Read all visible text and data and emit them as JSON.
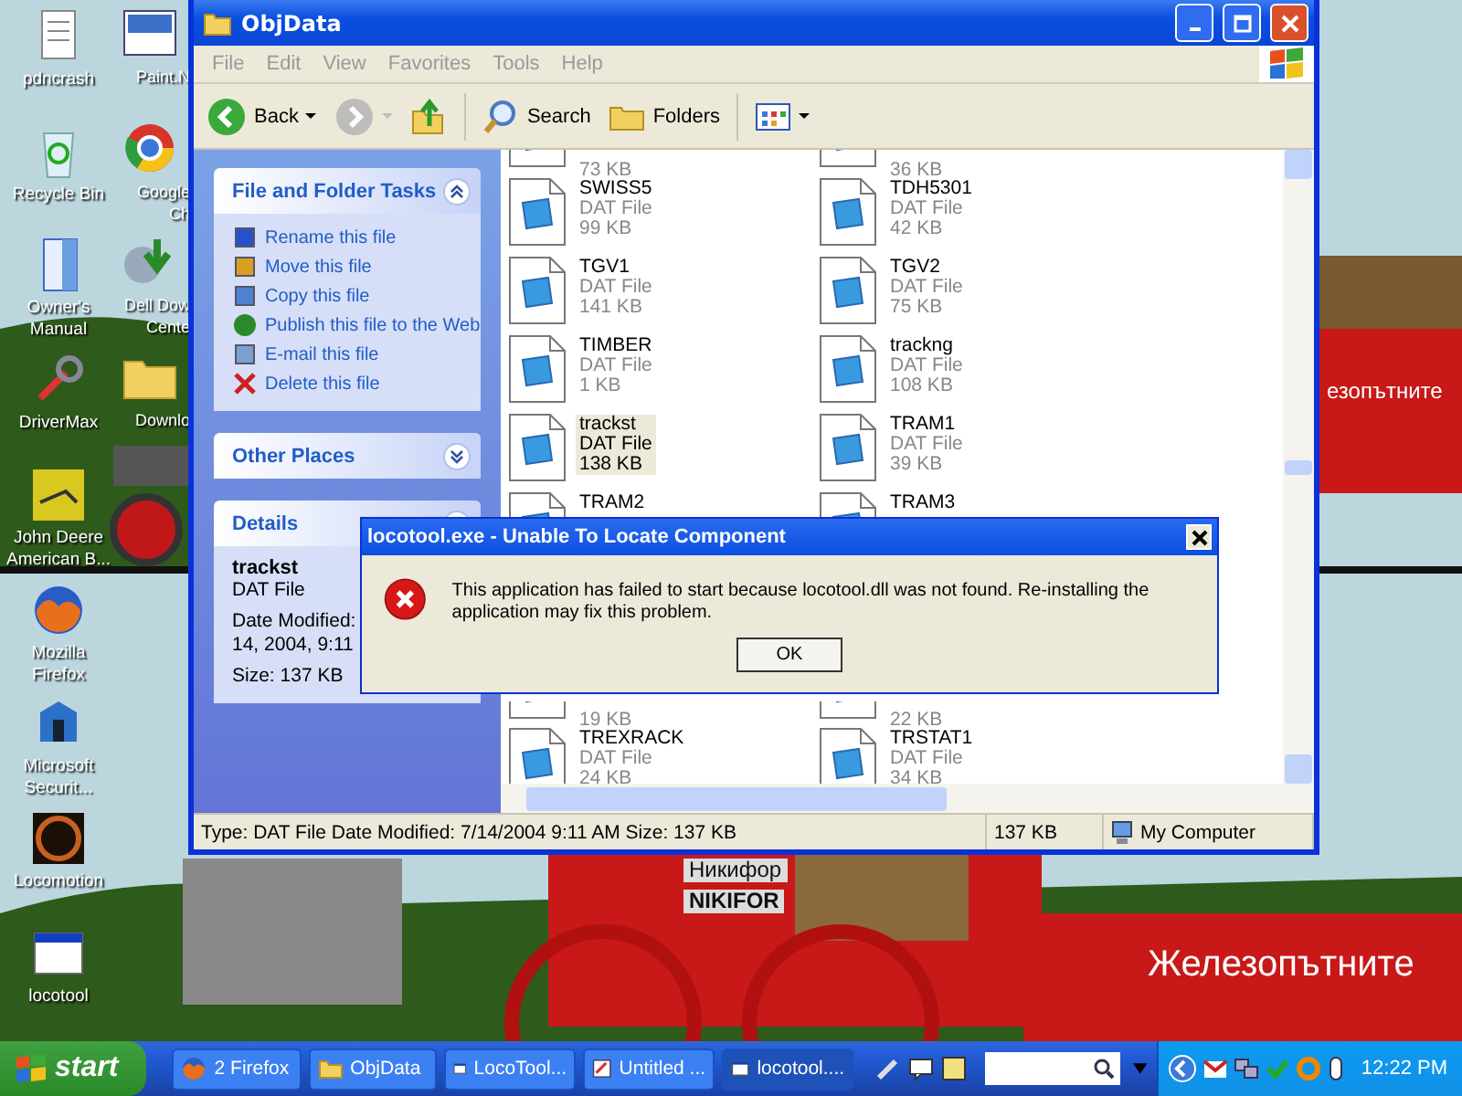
{
  "desktop": {
    "icons_column_1": [
      {
        "label": "pdncrash",
        "kind": "document"
      },
      {
        "label": "Recycle Bin",
        "kind": "recycle"
      },
      {
        "label": "Owner's Manual",
        "kind": "manual"
      },
      {
        "label": "DriverMax",
        "kind": "tools"
      },
      {
        "label": "John Deere American B...",
        "kind": "tractor"
      },
      {
        "label": "Mozilla Firefox",
        "kind": "firefox"
      },
      {
        "label": "Microsoft Securit...",
        "kind": "security"
      },
      {
        "label": "Locomotion",
        "kind": "loco"
      },
      {
        "label": "locotool",
        "kind": "window"
      }
    ],
    "icons_column_2": [
      {
        "label": "Paint.N",
        "kind": "paint"
      },
      {
        "label": "Google Ch",
        "kind": "chrome"
      },
      {
        "label": "Dell Dow Cente",
        "kind": "download"
      },
      {
        "label": "Downlo",
        "kind": "folder"
      }
    ]
  },
  "wallpaper": {
    "labels": [
      "езопътните",
      "Никифор",
      "NIKIFOR",
      "Железопътните"
    ]
  },
  "explorer": {
    "title": "ObjData",
    "menu": [
      "File",
      "Edit",
      "View",
      "Favorites",
      "Tools",
      "Help"
    ],
    "toolbar": [
      {
        "kind": "back",
        "label": "Back",
        "disabled": false
      },
      {
        "kind": "forward",
        "disabled": true
      },
      {
        "kind": "up",
        "disabled": false
      },
      {
        "kind": "search",
        "label": "Search",
        "disabled": false
      },
      {
        "kind": "folders",
        "label": "Folders",
        "disabled": false
      },
      {
        "kind": "views",
        "disabled": false
      }
    ],
    "panels": [
      {
        "kind": "tasks",
        "title": "File and Folder Tasks",
        "expanded": true,
        "links": [
          {
            "label": "Rename this file",
            "kind": "rename"
          },
          {
            "label": "Move this file",
            "kind": "move"
          },
          {
            "label": "Copy this file",
            "kind": "copy"
          },
          {
            "label": "Publish this file to the Web",
            "kind": "web"
          },
          {
            "label": "E-mail this file",
            "kind": "mail"
          },
          {
            "label": "Delete this file",
            "kind": "delete"
          }
        ]
      },
      {
        "kind": "places",
        "title": "Other Places",
        "expanded": false
      },
      {
        "kind": "details",
        "title": "Details",
        "expanded": true,
        "name": "trackst",
        "type": "DAT File",
        "lines": [
          "Date Modified:",
          "14, 2004, 9:11"
        ],
        "size": "Size: 137 KB"
      }
    ],
    "files": [
      {
        "items": [
          {
            "size": "73 KB",
            "selected": false
          },
          {
            "size": "36 KB",
            "selected": false
          }
        ]
      },
      {
        "items": [
          {
            "name": "SWISS5",
            "type": "DAT File",
            "size": "99 KB",
            "selected": false
          },
          {
            "name": "TDH5301",
            "type": "DAT File",
            "size": "42 KB",
            "selected": false
          }
        ]
      },
      {
        "items": [
          {
            "name": "TGV1",
            "type": "DAT File",
            "size": "141 KB",
            "selected": false
          },
          {
            "name": "TGV2",
            "type": "DAT File",
            "size": "75 KB",
            "selected": false
          }
        ]
      },
      {
        "items": [
          {
            "name": "TIMBER",
            "type": "DAT File",
            "size": "1 KB",
            "selected": false
          },
          {
            "name": "trackng",
            "type": "DAT File",
            "size": "108 KB",
            "selected": false
          }
        ]
      },
      {
        "items": [
          {
            "name": "trackst",
            "type": "DAT File",
            "size": "138 KB",
            "selected": true
          },
          {
            "name": "TRAM1",
            "type": "DAT File",
            "size": "39 KB",
            "selected": false
          }
        ]
      },
      {
        "items": [
          {
            "name": "TRAM2",
            "selected": false
          },
          {
            "name": "TRAM3",
            "selected": false
          }
        ]
      },
      {
        "items": [
          {
            "size": "19 KB",
            "selected": false
          },
          {
            "size": "22 KB",
            "selected": false
          }
        ]
      },
      {
        "items": [
          {
            "name": "TREXRACK",
            "type": "DAT File",
            "size": "24 KB",
            "selected": false
          },
          {
            "name": "TRSTAT1",
            "type": "DAT File",
            "size": "34 KB",
            "selected": false
          }
        ]
      }
    ],
    "status_bar": {
      "text": "Type: DAT File Date Modified: 7/14/2004 9:11 AM Size: 137 KB",
      "size": "137 KB",
      "location": "My Computer"
    }
  },
  "dialog": {
    "title": "locotool.exe - Unable To Locate Component",
    "message": "This application has failed to start because locotool.dll was not found. Re-installing the application may fix this problem.",
    "button": "OK"
  },
  "taskbar": {
    "start": "start",
    "tasks": [
      {
        "label": "2 Firefox",
        "kind": "firefox",
        "selected": false
      },
      {
        "label": "ObjData",
        "kind": "folder",
        "selected": false
      },
      {
        "label": "LocoTool...",
        "kind": "window",
        "selected": false
      },
      {
        "label": "Untitled ...",
        "kind": "paint",
        "selected": false
      },
      {
        "label": "locotool....",
        "kind": "window",
        "selected": true
      }
    ],
    "clock": "12:22 PM"
  }
}
